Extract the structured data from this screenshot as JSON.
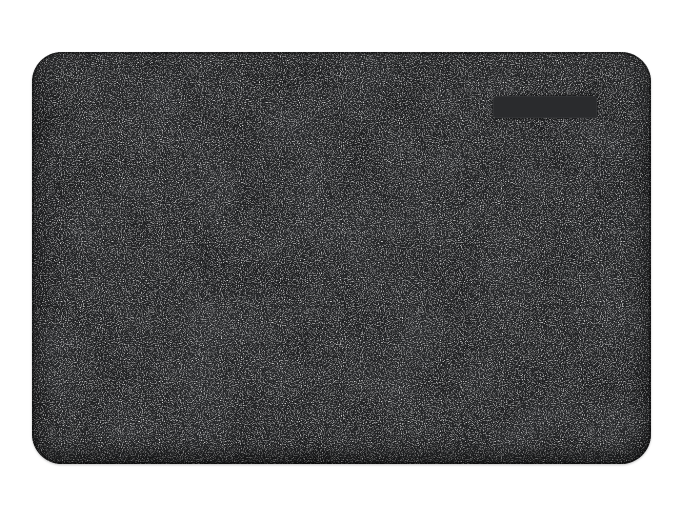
{
  "product": {
    "name": "anti-fatigue-floor-mat",
    "surface_color": "#2b2c2e",
    "speckle_color": "#d9d9d9",
    "label_tag_color": "#2a2b2d"
  }
}
